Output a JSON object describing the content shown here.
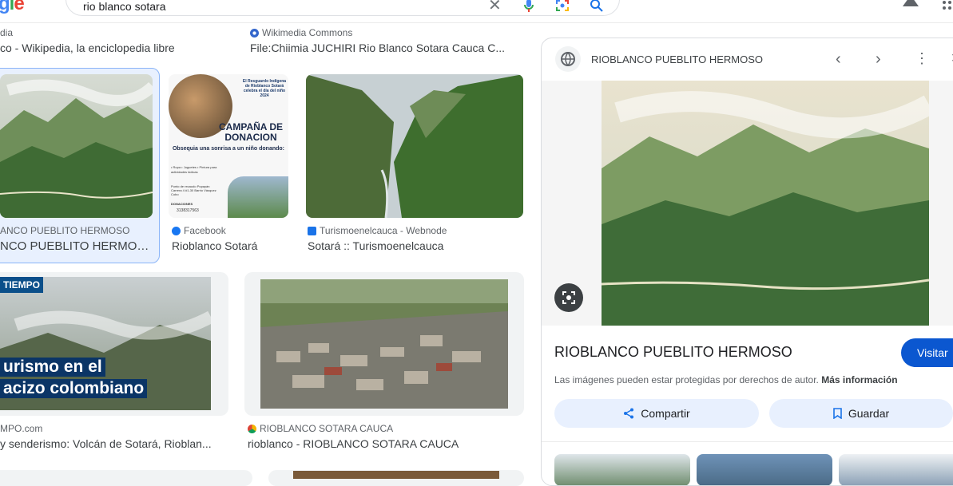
{
  "header": {
    "logo_partial": "gle",
    "search_value": "rio blanco sotara"
  },
  "top_row": [
    {
      "source": "dia",
      "title": "co - Wikipedia, la enciclopedia libre"
    },
    {
      "source": "Wikimedia Commons",
      "title": "File:Chiimia JUCHIRI Rio Blanco Sotara Cauca C..."
    }
  ],
  "row1": [
    {
      "source": "ANCO PUEBLITO HERMOSO",
      "title": "NCO PUEBLITO HERMOSO"
    },
    {
      "source": "Facebook",
      "title": "Rioblanco Sotará"
    },
    {
      "source": "Turismoenelcauca - Webnode",
      "title": "Sotará :: Turismoenelcauca"
    }
  ],
  "poster": {
    "head": "El Resguardo Indígena de Rioblanco Sotará celebra el día del niño 2024",
    "campaign": "CAMPAÑA DE DONACION",
    "sub": "Obsequia una sonrisa a un niño donando:",
    "items": "• Ropa • Juguetes • Pintura para actividades lúdicas",
    "point": "Punto de recaudo Popayán Carrera 4 #1-30 Barrio Vásquez Cobo",
    "don": "DONACIONES",
    "phone": "3138317563"
  },
  "row2": [
    {
      "source": "MPO.com",
      "title": "y senderismo: Volcán de Sotará, Rioblan..."
    },
    {
      "source": "RIOBLANCO SOTARA CAUCA",
      "title": "rioblanco - RIOBLANCO SOTARA CAUCA"
    }
  ],
  "news": {
    "badge": "TIEMPO",
    "line1": "urismo en el",
    "line2": "acizo colombiano"
  },
  "panel": {
    "site_name": "RIOBLANCO PUEBLITO HERMOSO",
    "title": "RIOBLANCO PUEBLITO HERMOSO",
    "visit_label": "Visitar",
    "copyright": "Las imágenes pueden estar protegidas por derechos de autor.",
    "more_info": "Más información",
    "share_label": "Compartir",
    "save_label": "Guardar"
  },
  "colors": {
    "accent": "#1a73e8",
    "pill": "#e8f0fe",
    "selected_border": "#8ab4f8"
  }
}
